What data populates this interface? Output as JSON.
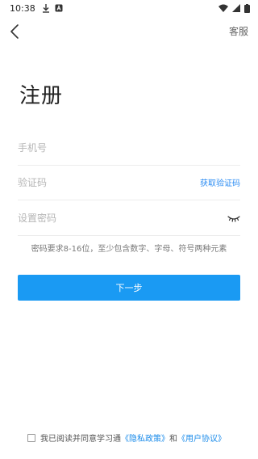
{
  "status_bar": {
    "time": "10:38"
  },
  "nav": {
    "back_icon": "chevron-left-icon",
    "service_label": "客服"
  },
  "page": {
    "title": "注册"
  },
  "form": {
    "phone_placeholder": "手机号",
    "code_placeholder": "验证码",
    "get_code_label": "获取验证码",
    "password_placeholder": "设置密码",
    "password_hint": "密码要求8-16位，至少包含数字、字母、符号两种元素",
    "next_label": "下一步"
  },
  "agreement": {
    "checked": false,
    "prefix": "我已阅读并同意学习通",
    "privacy_link": "《隐私政策》",
    "conjunction": "和",
    "user_agreement_link": "《用户协议》"
  },
  "colors": {
    "accent": "#1a9af3",
    "link": "#1a8bea"
  }
}
